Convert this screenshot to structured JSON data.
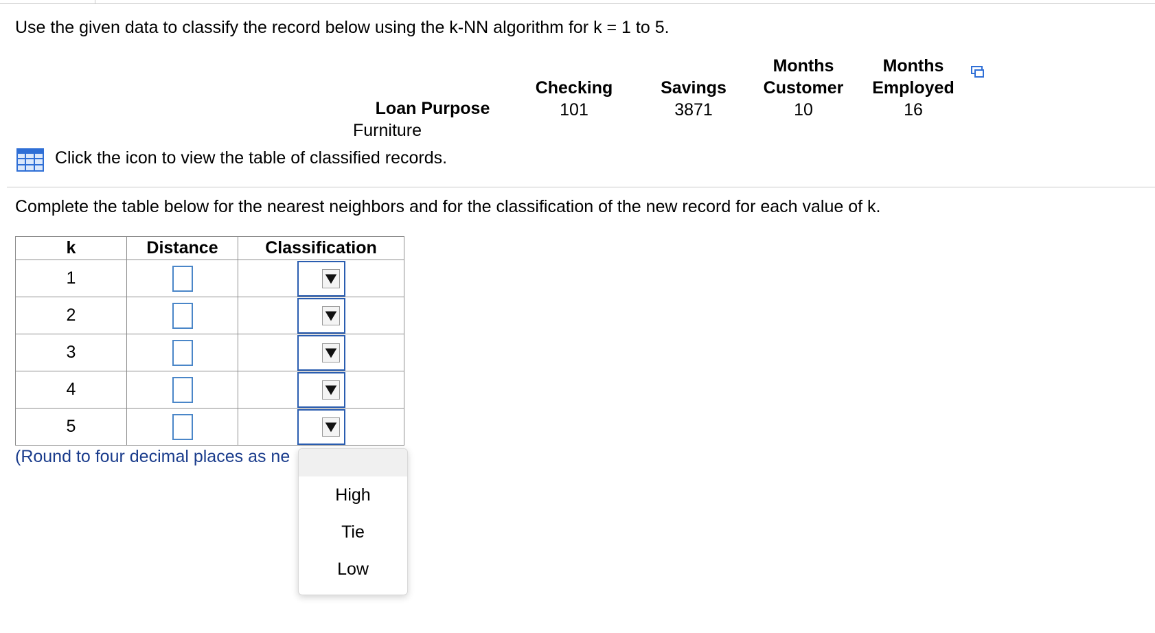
{
  "prompt": "Use the given data to classify the record below using the k-NN algorithm for k = 1 to 5.",
  "record": {
    "headers": [
      {
        "line1": "",
        "line2": "Loan Purpose"
      },
      {
        "line1": "",
        "line2": "Checking"
      },
      {
        "line1": "",
        "line2": "Savings"
      },
      {
        "line1": "Months",
        "line2": "Customer"
      },
      {
        "line1": "Months",
        "line2": "Employed"
      }
    ],
    "values": [
      "Furniture",
      "101",
      "3871",
      "10",
      "16"
    ]
  },
  "icon_link_text": "Click the icon to view the table of classified records.",
  "instruction": "Complete the table below for the nearest neighbors and for the classification of the new record for each value of k.",
  "answer_table": {
    "headers": [
      "k",
      "Distance",
      "Classification"
    ],
    "rows": [
      {
        "k": "1"
      },
      {
        "k": "2"
      },
      {
        "k": "3"
      },
      {
        "k": "4"
      },
      {
        "k": "5"
      }
    ]
  },
  "round_note": "(Round to four decimal places as ne",
  "dropdown_options": [
    "High",
    "Tie",
    "Low"
  ],
  "icons": {
    "copy": "copy-icon",
    "table": "table-grid-icon",
    "select_arrow": "triangle-down-icon"
  },
  "colors": {
    "input_border": "#4a86c8",
    "select_border": "#2a5db0",
    "note_text": "#1a3c8c",
    "grid_icon": "#2f6fd6"
  }
}
